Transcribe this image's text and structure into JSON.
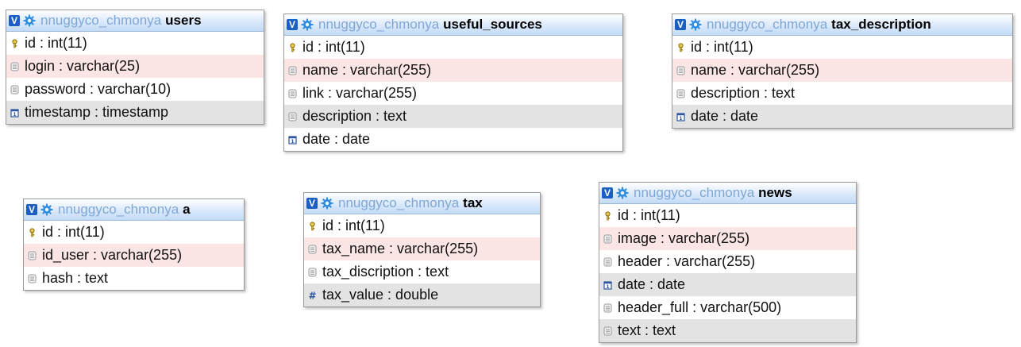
{
  "database": "nnuggyco_chmonya",
  "tables": [
    {
      "name": "users",
      "fields": [
        {
          "label": "id : int(11)",
          "icon": "key-icon",
          "bg": "white"
        },
        {
          "label": "login : varchar(25)",
          "icon": "text-field-icon",
          "bg": "pink"
        },
        {
          "label": "password : varchar(10)",
          "icon": "text-field-icon",
          "bg": "white"
        },
        {
          "label": "timestamp : timestamp",
          "icon": "date-icon",
          "bg": "grey"
        }
      ]
    },
    {
      "name": "useful_sources",
      "fields": [
        {
          "label": "id : int(11)",
          "icon": "key-icon",
          "bg": "white"
        },
        {
          "label": "name : varchar(255)",
          "icon": "text-field-icon",
          "bg": "pink"
        },
        {
          "label": "link : varchar(255)",
          "icon": "text-field-icon",
          "bg": "white"
        },
        {
          "label": "description : text",
          "icon": "text-field-icon",
          "bg": "grey"
        },
        {
          "label": "date : date",
          "icon": "date-icon",
          "bg": "white"
        }
      ]
    },
    {
      "name": "tax_description",
      "fields": [
        {
          "label": "id : int(11)",
          "icon": "key-icon",
          "bg": "white"
        },
        {
          "label": "name : varchar(255)",
          "icon": "text-field-icon",
          "bg": "pink"
        },
        {
          "label": "description : text",
          "icon": "text-field-icon",
          "bg": "white"
        },
        {
          "label": "date : date",
          "icon": "date-icon",
          "bg": "grey"
        }
      ]
    },
    {
      "name": "a",
      "fields": [
        {
          "label": "id : int(11)",
          "icon": "key-icon",
          "bg": "white"
        },
        {
          "label": "id_user : varchar(255)",
          "icon": "text-field-icon",
          "bg": "pink"
        },
        {
          "label": "hash : text",
          "icon": "text-field-icon",
          "bg": "white"
        }
      ]
    },
    {
      "name": "tax",
      "fields": [
        {
          "label": "id : int(11)",
          "icon": "key-icon",
          "bg": "white"
        },
        {
          "label": "tax_name : varchar(255)",
          "icon": "text-field-icon",
          "bg": "pink"
        },
        {
          "label": "tax_discription : text",
          "icon": "text-field-icon",
          "bg": "white"
        },
        {
          "label": "tax_value : double",
          "icon": "numeric-icon",
          "bg": "grey"
        }
      ]
    },
    {
      "name": "news",
      "fields": [
        {
          "label": "id : int(11)",
          "icon": "key-icon",
          "bg": "white"
        },
        {
          "label": "image : varchar(255)",
          "icon": "text-field-icon",
          "bg": "pink"
        },
        {
          "label": "header : varchar(255)",
          "icon": "text-field-icon",
          "bg": "white"
        },
        {
          "label": "date : date",
          "icon": "date-icon",
          "bg": "grey"
        },
        {
          "label": "header_full : varchar(500)",
          "icon": "text-field-icon",
          "bg": "white"
        },
        {
          "label": "text : text",
          "icon": "text-field-icon",
          "bg": "grey"
        }
      ]
    }
  ]
}
